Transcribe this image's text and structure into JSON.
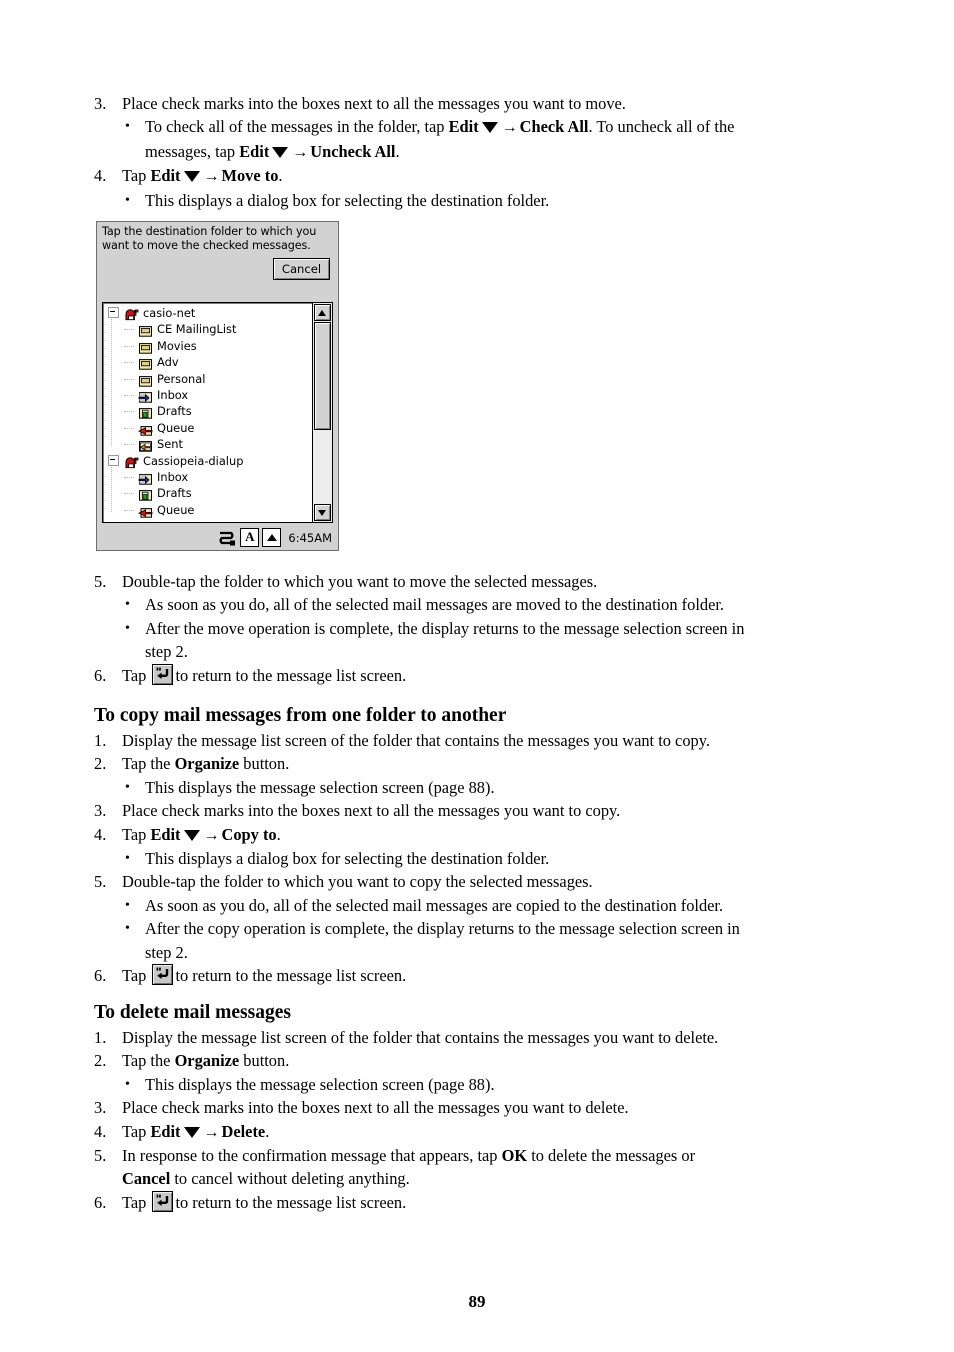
{
  "document": {
    "page_number": "89"
  },
  "section_move": {
    "steps": [
      {
        "num": "3.",
        "text": "Place check marks into the boxes next to all the messages you want to move."
      },
      {
        "num": "4.",
        "pre": "Tap ",
        "bold1": "Edit",
        "arrow": "→",
        "bold2": "Move to",
        "post": "."
      }
    ],
    "bullet_check_all": {
      "line1_pre": "To check all of the messages in the folder, tap ",
      "bold1": "Edit",
      "arrow": "→",
      "bold2": "Check All",
      "line1_post": ". To uncheck all of the",
      "line2_pre": "messages, tap ",
      "bold3": "Edit",
      "bold4": "Uncheck All",
      "line2_post": "."
    },
    "bullet_dialog": "This displays a dialog box for selecting the destination folder.",
    "step5": {
      "num": "5.",
      "text": "Double-tap the folder to which you want to move the selected messages."
    },
    "bullet5a": "As soon as you do, all of the selected mail messages are moved to the destination folder.",
    "bullet5b_line1": "After the move operation is complete, the display returns to the message selection screen in",
    "bullet5b_line2": "step 2.",
    "step6": {
      "num": "6.",
      "pre": "Tap ",
      "post": "to return to the message list screen."
    }
  },
  "figure": {
    "prompt": "Tap the destination folder to which you want to move the checked messages.",
    "cancel_label": "Cancel",
    "clock": "6:45AM",
    "status_letter": "A",
    "tree": [
      {
        "label": "casio-net",
        "level": "root",
        "icon": "mailbox-icon",
        "expanded": true
      },
      {
        "label": "CE MailingList",
        "level": "child",
        "icon": "folder-icon"
      },
      {
        "label": "Movies",
        "level": "child",
        "icon": "folder-icon"
      },
      {
        "label": "Adv",
        "level": "child",
        "icon": "folder-icon"
      },
      {
        "label": "Personal",
        "level": "child",
        "icon": "folder-icon"
      },
      {
        "label": "Inbox",
        "level": "child",
        "icon": "inbox-icon"
      },
      {
        "label": "Drafts",
        "level": "child",
        "icon": "drafts-icon"
      },
      {
        "label": "Queue",
        "level": "child",
        "icon": "queue-icon"
      },
      {
        "label": "Sent",
        "level": "child",
        "icon": "sent-icon"
      },
      {
        "label": "Cassiopeia-dialup",
        "level": "root",
        "icon": "mailbox-icon",
        "expanded": true
      },
      {
        "label": "Inbox",
        "level": "child",
        "icon": "inbox-icon"
      },
      {
        "label": "Drafts",
        "level": "child",
        "icon": "drafts-icon"
      },
      {
        "label": "Queue",
        "level": "child",
        "icon": "queue-icon"
      }
    ]
  },
  "section_copy": {
    "heading": "To copy mail messages from one folder to another",
    "step1": {
      "num": "1.",
      "text": "Display the message list screen of the folder that contains the messages you want to copy."
    },
    "step2": {
      "num": "2.",
      "pre": "Tap the ",
      "bold": "Organize",
      "post": " button."
    },
    "bullet2": "This displays the message selection screen (page 88).",
    "step3": {
      "num": "3.",
      "text": "Place check marks into the boxes next to all the messages you want to copy."
    },
    "step4": {
      "num": "4.",
      "pre": "Tap ",
      "bold1": "Edit",
      "arrow": "→",
      "bold2": "Copy to",
      "post": "."
    },
    "bullet4": "This displays a dialog box for selecting the destination folder.",
    "step5": {
      "num": "5.",
      "text": "Double-tap the folder to which you want to copy the selected messages."
    },
    "bullet5a": "As soon as you do, all of the selected mail messages are copied to the destination folder.",
    "bullet5b_line1": "After the copy operation is complete, the display returns to the message selection screen in",
    "bullet5b_line2": "step 2.",
    "step6": {
      "num": "6.",
      "pre": "Tap ",
      "post": "to return to the message list screen."
    }
  },
  "section_delete": {
    "heading": "To delete mail messages",
    "step1": {
      "num": "1.",
      "text": "Display the message list screen of the folder that contains the messages you want to delete."
    },
    "step2": {
      "num": "2.",
      "pre": "Tap the ",
      "bold": "Organize",
      "post": " button."
    },
    "bullet2": "This displays the message selection screen (page 88).",
    "step3": {
      "num": "3.",
      "text": "Place check marks into the boxes next to all the messages you want to delete."
    },
    "step4": {
      "num": "4.",
      "pre": "Tap ",
      "bold1": "Edit",
      "arrow": "→",
      "bold2": "Delete",
      "post": "."
    },
    "step5": {
      "num": "5.",
      "line1_pre": "In response to the confirmation message that appears, tap ",
      "bold_ok": "OK",
      "line1_post": " to delete the messages or",
      "bold_cancel": "Cancel",
      "line2_post": " to cancel without deleting anything."
    },
    "step6": {
      "num": "6.",
      "pre": "Tap ",
      "post": "to return to the message list screen."
    }
  }
}
